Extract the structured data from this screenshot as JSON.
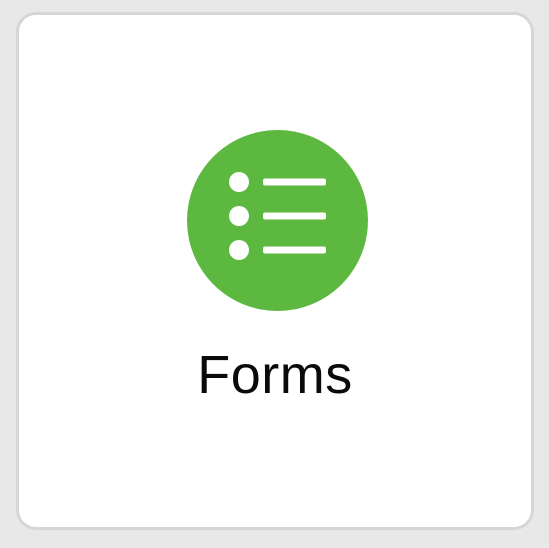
{
  "app_tile": {
    "label": "Forms",
    "icon": "list-bullets-icon",
    "icon_color": "#5CB83E",
    "icon_glyph_color": "#FFFFFF",
    "tile_background": "#FFFFFF",
    "tile_border_color": "#D6D6D6"
  }
}
